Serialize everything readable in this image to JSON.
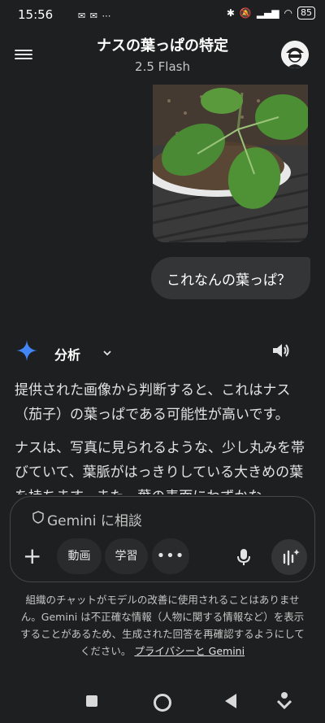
{
  "status_bar": {
    "time": "15:56",
    "left_icons": "✉ ✉ ⋯",
    "battery": "85"
  },
  "header": {
    "title": "ナスの葉っぱの特定",
    "model": "2.5 Flash"
  },
  "conversation": {
    "user_message": "これなんの葉っぱ？",
    "response_mode_label": "分析",
    "paragraph_1": "提供された画像から判断すると、これはナス（茄子）の葉っぱである可能性が高いです。",
    "paragraph_2": "ナスは、写真に見られるような、少し丸みを帯びていて、葉脈がはっきりしている大きめの葉を持ちます。また、葉の表面にわずかな"
  },
  "input": {
    "placeholder": "Gemini に相談",
    "chip_video": "動画",
    "chip_study": "学習",
    "chip_more": "•••"
  },
  "disclaimer": {
    "text": "組織のチャットがモデルの改善に使用されることはありません。Gemini は不正確な情報（人物に関する情報など）を表示することがあるため、生成された回答を再確認するようにしてください。",
    "link": "プライバシーと Gemini"
  },
  "icons": [
    "menu-icon",
    "avatar",
    "gemini-star-icon",
    "chevron-down-icon",
    "speaker-icon",
    "shield-icon",
    "plus-icon",
    "mic-icon",
    "live-icon"
  ],
  "colors": {
    "background": "#1e1f20",
    "bubble": "#333537",
    "accent_blue": "#4285f4"
  }
}
